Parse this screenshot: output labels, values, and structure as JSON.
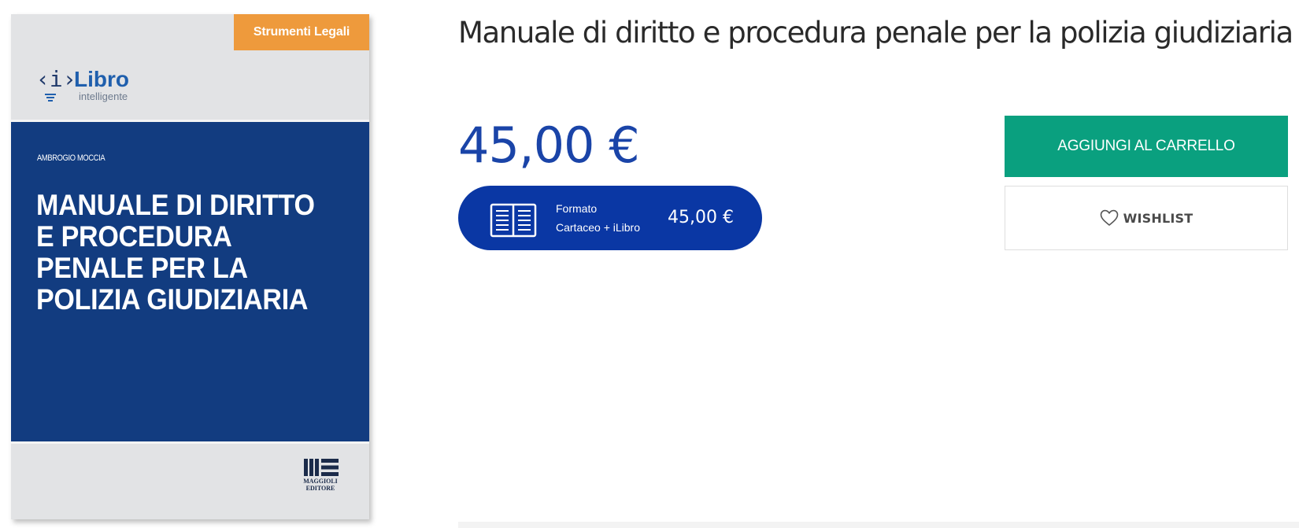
{
  "cover": {
    "series_tag": "Strumenti Legali",
    "brand_mark": "‹i›",
    "brand_word": "Libro",
    "brand_sub": "intelligente",
    "author": "AMBROGIO MOCCIA",
    "title": "MANUALE DI DIRITTO E PROCEDURA PENALE PER LA POLIZIA GIUDIZIARIA",
    "publisher": "MAGGIOLI EDITORE"
  },
  "product": {
    "title": "Manuale di diritto e procedura penale per la polizia giudiziaria",
    "price": "45,00 €",
    "format": {
      "label": "Formato",
      "type": "Cartaceo + iLibro",
      "price": "45,00 €",
      "icon": "book-open-icon"
    }
  },
  "actions": {
    "cart_label": "AGGIUNGI AL CARRELLO",
    "wishlist_label": "WISHLIST",
    "wishlist_icon": "heart-icon"
  },
  "colors": {
    "cover_blue": "#123c80",
    "tag_orange": "#ee9a3c",
    "price_blue": "#1a44a8",
    "pill_blue": "#0a37a4",
    "cart_green": "#0aa07f"
  }
}
